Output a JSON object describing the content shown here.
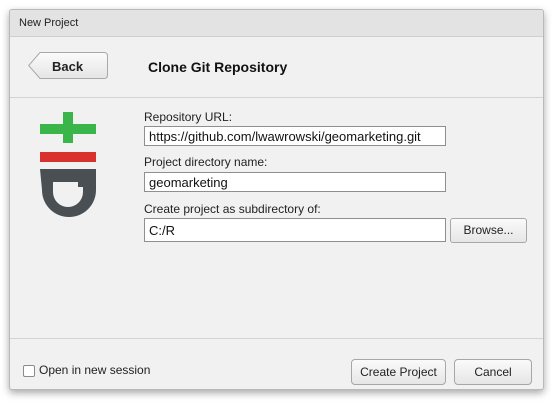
{
  "window": {
    "title": "New Project"
  },
  "header": {
    "back_label": "Back",
    "heading": "Clone Git Repository"
  },
  "logo": {
    "name": "git-icon",
    "colors": {
      "green": "#39b54a",
      "red": "#d9312e",
      "dark": "#4a4f54"
    }
  },
  "form": {
    "repo_url": {
      "label": "Repository URL:",
      "value": "https://github.com/lwawrowski/geomarketing.git"
    },
    "dir_name": {
      "label": "Project directory name:",
      "value": "geomarketing"
    },
    "subdir": {
      "label": "Create project as subdirectory of:",
      "value": "C:/R"
    },
    "browse_label": "Browse..."
  },
  "footer": {
    "open_new_session_label": "Open in new session",
    "open_new_session_checked": false,
    "create_label": "Create Project",
    "cancel_label": "Cancel"
  }
}
